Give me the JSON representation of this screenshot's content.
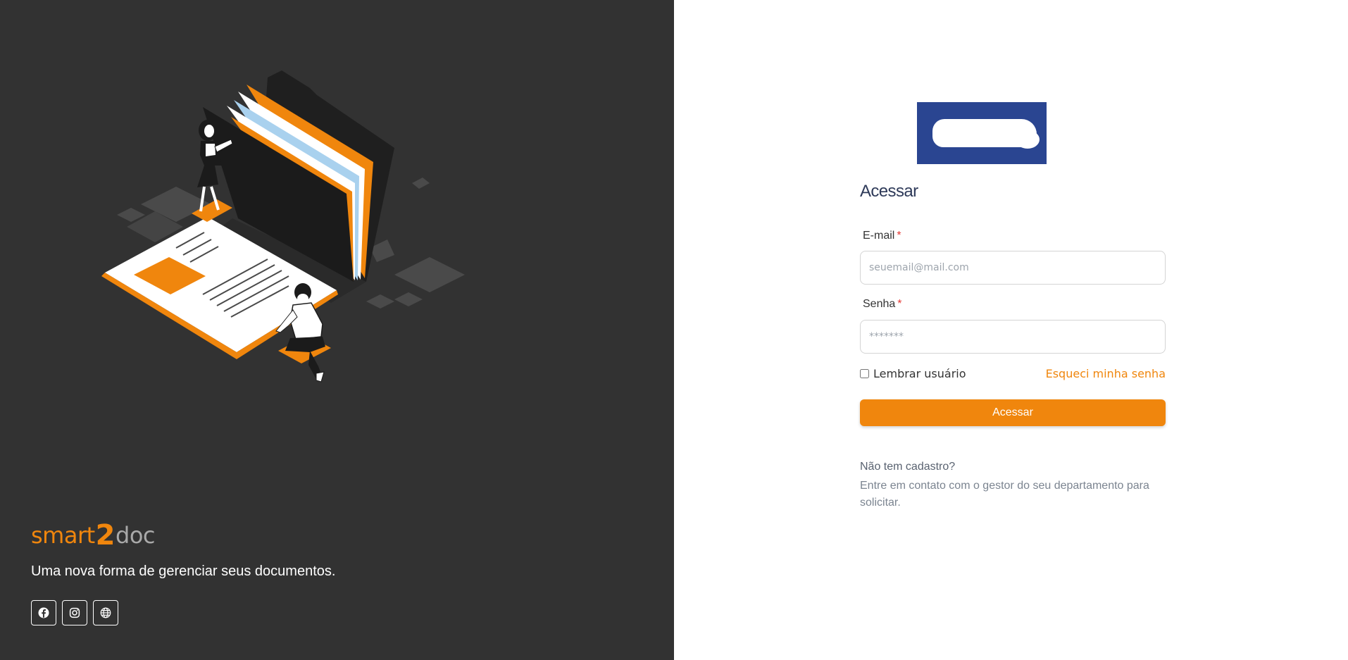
{
  "left_panel": {
    "brand": {
      "part1": "smart",
      "part2": "2",
      "part3": "doc"
    },
    "tagline": "Uma nova forma de gerenciar seus documentos.",
    "socials": [
      {
        "icon": "facebook-icon"
      },
      {
        "icon": "instagram-icon"
      },
      {
        "icon": "globe-icon"
      }
    ]
  },
  "login": {
    "title": "Acessar",
    "email": {
      "label": "E-mail",
      "required_mark": "*",
      "placeholder": "seuemail@mail.com",
      "value": ""
    },
    "password": {
      "label": "Senha",
      "required_mark": "*",
      "placeholder": "*******",
      "value": ""
    },
    "remember_label": "Lembrar usuário",
    "remember_checked": false,
    "forgot_label": "Esqueci minha senha",
    "submit_label": "Acessar",
    "no_register_title": "Não tem cadastro?",
    "no_register_text": "Entre em contato com o gestor do seu departamento para solicitar."
  },
  "colors": {
    "accent": "#f0860d",
    "left_bg": "#323232",
    "logo_bg": "#2a4591",
    "title_text": "#2e3a59"
  }
}
